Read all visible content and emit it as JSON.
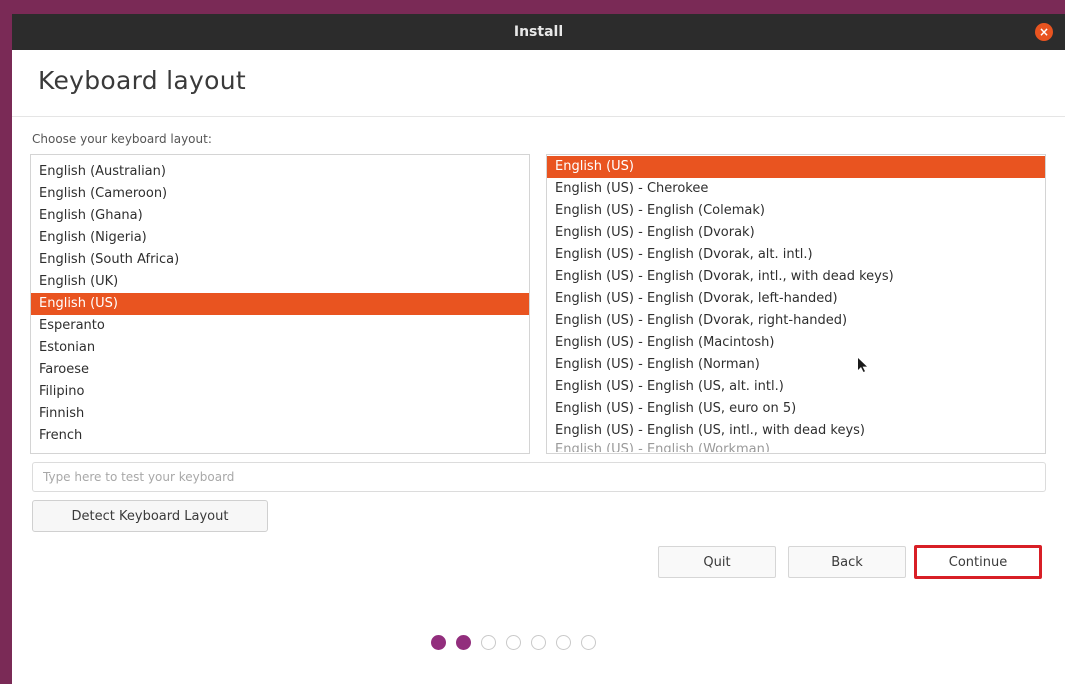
{
  "window": {
    "title": "Install",
    "close_glyph": "×",
    "accent_color": "#e95420"
  },
  "page": {
    "title": "Keyboard layout",
    "prompt": "Choose your keyboard layout:"
  },
  "layouts": [
    "English (Australian)",
    "English (Cameroon)",
    "English (Ghana)",
    "English (Nigeria)",
    "English (South Africa)",
    "English (UK)",
    "English (US)",
    "Esperanto",
    "Estonian",
    "Faroese",
    "Filipino",
    "Finnish",
    "French"
  ],
  "selected_layout": "English (US)",
  "variants": [
    "English (US)",
    "English (US) - Cherokee",
    "English (US) - English (Colemak)",
    "English (US) - English (Dvorak)",
    "English (US) - English (Dvorak, alt. intl.)",
    "English (US) - English (Dvorak, intl., with dead keys)",
    "English (US) - English (Dvorak, left-handed)",
    "English (US) - English (Dvorak, right-handed)",
    "English (US) - English (Macintosh)",
    "English (US) - English (Norman)",
    "English (US) - English (US, alt. intl.)",
    "English (US) - English (US, euro on 5)",
    "English (US) - English (US, intl., with dead keys)"
  ],
  "variants_partial": "English (US) - English (Workman)",
  "selected_variant": "English (US)",
  "test_input": {
    "placeholder": "Type here to test your keyboard",
    "value": ""
  },
  "detect_button": "Detect Keyboard Layout",
  "buttons": {
    "quit": "Quit",
    "back": "Back",
    "continue": "Continue"
  },
  "progress": {
    "total_steps": 7,
    "completed_steps": 2
  },
  "icons": {
    "close": "close-icon",
    "cursor": "mouse-pointer-icon"
  }
}
